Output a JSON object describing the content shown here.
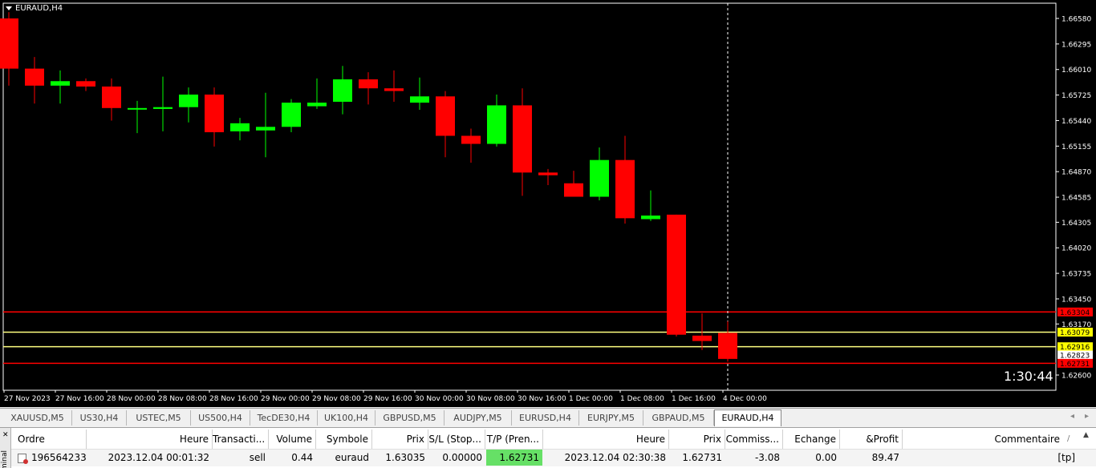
{
  "chart": {
    "title": "EURAUD,H4",
    "countdown": "1:30:44",
    "colors": {
      "bull": "#00ff00",
      "bear": "#ff0000",
      "line_red": "#ff0000",
      "line_yellow": "#ffff80",
      "bg": "#000000",
      "axis": "#ffffff"
    }
  },
  "chart_data": {
    "type": "candlestick",
    "symbol": "EURAUD",
    "timeframe": "H4",
    "ylim": [
      1.6243,
      1.6675
    ],
    "y_ticks": [
      "1.66580",
      "1.66295",
      "1.66010",
      "1.65725",
      "1.65440",
      "1.65155",
      "1.64870",
      "1.64585",
      "1.64305",
      "1.64020",
      "1.63735",
      "1.63450",
      "1.63170",
      "1.62600"
    ],
    "x_ticks": [
      "27 Nov 2023",
      "27 Nov 16:00",
      "28 Nov 00:00",
      "28 Nov 08:00",
      "28 Nov 16:00",
      "29 Nov 00:00",
      "29 Nov 08:00",
      "29 Nov 16:00",
      "30 Nov 00:00",
      "30 Nov 08:00",
      "30 Nov 16:00",
      "1 Dec 00:00",
      "1 Dec 08:00",
      "1 Dec 16:00",
      "4 Dec 00:00"
    ],
    "candles": [
      [
        1.6658,
        1.6665,
        1.6583,
        1.6602
      ],
      [
        1.6602,
        1.6615,
        1.6563,
        1.6583
      ],
      [
        1.6583,
        1.66,
        1.6563,
        1.6588
      ],
      [
        1.6588,
        1.6591,
        1.6577,
        1.6582
      ],
      [
        1.6582,
        1.6591,
        1.6544,
        1.6558
      ],
      [
        1.6557,
        1.6566,
        1.653,
        1.6558
      ],
      [
        1.6557,
        1.6593,
        1.6532,
        1.6559
      ],
      [
        1.6559,
        1.6581,
        1.6542,
        1.6573
      ],
      [
        1.6573,
        1.6581,
        1.6515,
        1.6531
      ],
      [
        1.6532,
        1.6547,
        1.6522,
        1.6541
      ],
      [
        1.6533,
        1.6575,
        1.6503,
        1.6537
      ],
      [
        1.6537,
        1.6568,
        1.6531,
        1.6564
      ],
      [
        1.656,
        1.6591,
        1.6557,
        1.6564
      ],
      [
        1.6565,
        1.6605,
        1.6551,
        1.659
      ],
      [
        1.659,
        1.6598,
        1.6562,
        1.658
      ],
      [
        1.658,
        1.66,
        1.6565,
        1.6577
      ],
      [
        1.6564,
        1.6592,
        1.6556,
        1.6571
      ],
      [
        1.6571,
        1.6577,
        1.6503,
        1.6527
      ],
      [
        1.6527,
        1.6535,
        1.6497,
        1.6518
      ],
      [
        1.6518,
        1.6573,
        1.6515,
        1.6561
      ],
      [
        1.6561,
        1.658,
        1.646,
        1.6486
      ],
      [
        1.6486,
        1.649,
        1.6472,
        1.6483
      ],
      [
        1.6474,
        1.6488,
        1.646,
        1.6459
      ],
      [
        1.6459,
        1.6514,
        1.6455,
        1.65
      ],
      [
        1.65,
        1.6527,
        1.6429,
        1.6435
      ],
      [
        1.6434,
        1.6466,
        1.6432,
        1.6438
      ],
      [
        1.6439,
        1.6439,
        1.6303,
        1.6305
      ],
      [
        1.6304,
        1.6329,
        1.6288,
        1.6298
      ],
      [
        1.6307,
        1.632,
        1.6275,
        1.6278
      ]
    ],
    "horizontal_lines": [
      {
        "price": 1.63304,
        "color": "#ff0000",
        "label": "1.63304"
      },
      {
        "price": 1.63079,
        "color": "#ffff80",
        "label": "1.63079"
      },
      {
        "price": 1.62916,
        "color": "#ffff80",
        "label": "1.62916"
      },
      {
        "price": 1.62731,
        "color": "#ff0000",
        "label": "1.62731"
      }
    ],
    "price_labels": [
      {
        "text": "1.63304",
        "bg": "#ff0000",
        "fg": "#000000",
        "price": 1.63304
      },
      {
        "text": "1.63079",
        "bg": "#ffff00",
        "fg": "#000000",
        "price": 1.63079
      },
      {
        "text": "1.62916",
        "bg": "#ffff00",
        "fg": "#000000",
        "price": 1.62916
      },
      {
        "text": "1.62823",
        "bg": "#ffffff",
        "fg": "#000000",
        "price": 1.62823
      },
      {
        "text": "1.62731",
        "bg": "#ff0000",
        "fg": "#000000",
        "price": 1.62731
      }
    ],
    "crosshair_candle_index": 28
  },
  "tabs": [
    {
      "label": "XAUUSD,M5",
      "active": false
    },
    {
      "label": "US30,H4",
      "active": false
    },
    {
      "label": "USTEC,M5",
      "active": false
    },
    {
      "label": "US500,H4",
      "active": false
    },
    {
      "label": "TecDE30,H4",
      "active": false
    },
    {
      "label": "UK100,H4",
      "active": false
    },
    {
      "label": "GBPUSD,M5",
      "active": false
    },
    {
      "label": "AUDJPY,M5",
      "active": false
    },
    {
      "label": "EURUSD,H4",
      "active": false
    },
    {
      "label": "EURJPY,M5",
      "active": false
    },
    {
      "label": "GBPAUD,M5",
      "active": false
    },
    {
      "label": "EURAUD,H4",
      "active": true
    }
  ],
  "terminal": {
    "side_label": "minal",
    "columns": [
      "Ordre",
      "Heure",
      "Transacti...",
      "Volume",
      "Symbole",
      "Prix",
      "S/L (Stop...",
      "T/P (Pren...",
      "Heure",
      "Prix",
      "Commiss...",
      "Echange",
      "&Profit",
      "Commentaire"
    ],
    "row": {
      "ordre": "196564233",
      "heure_ouverture": "2023.12.04 00:01:32",
      "transaction": "sell",
      "volume": "0.44",
      "symbole": "euraud",
      "prix_ouverture": "1.63035",
      "sl": "0.00000",
      "tp": "1.62731",
      "heure_fermeture": "2023.12.04 02:30:38",
      "prix_fermeture": "1.62731",
      "commission": "-3.08",
      "echange": "0.00",
      "profit": "89.47",
      "commentaire": "[tp]"
    }
  }
}
